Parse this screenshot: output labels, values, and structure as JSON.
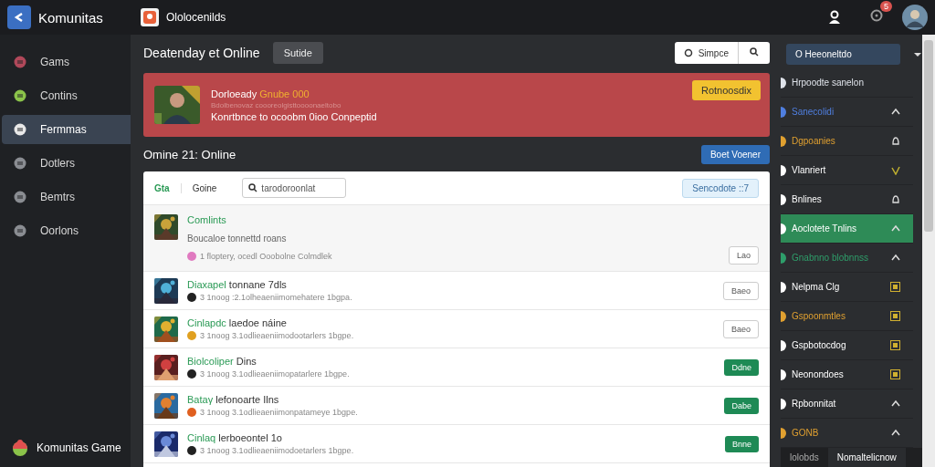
{
  "topbar": {
    "app_title": "Komunitas",
    "tab_title": "Ololocenilds",
    "notification_count": "5"
  },
  "sidebar": {
    "items": [
      {
        "label": "Gams",
        "selected": false,
        "color": "#b0485a"
      },
      {
        "label": "Contins",
        "selected": false,
        "color": "#8bc34a"
      },
      {
        "label": "Fermmas",
        "selected": true,
        "color": "#e8e8e8"
      },
      {
        "label": "Dotlers",
        "selected": false,
        "color": "#8a8d92"
      },
      {
        "label": "Bemtrs",
        "selected": false,
        "color": "#8a8d92"
      },
      {
        "label": "Oorlons",
        "selected": false,
        "color": "#8a8d92"
      }
    ],
    "footer": "Komunitas Game"
  },
  "main": {
    "heading": "Deatenday et Online",
    "heading_button": "Sutide",
    "search_placeholder": "Simpce",
    "banner": {
      "name": "Dorloeady",
      "tag": "Gnube 000",
      "subtitle": "Bdolbenovaz coooreolgisttoooonaeltobo",
      "message": "Konrtbnce to ocoobm 0ioo Conpeptid",
      "button": "Rotnoosdix"
    },
    "section_title": "Omine 21: Online",
    "section_button": "Boet Voener",
    "list": {
      "tab_label": "Gta",
      "filter_label": "Goine",
      "search_placeholder": "tarodoroonlat",
      "sort_button": "Sencodote ::7",
      "rows": [
        {
          "title_highlight": "Comlints",
          "title": "",
          "description": "Boucaloe tonnettd roans",
          "meta": "1 floptery, ocedl Ooobolne Colmdlek",
          "button": "Lao",
          "kind": "outline"
        },
        {
          "title_highlight": "Diaxapel",
          "title": "tonnane 7dls",
          "meta": "3 1noog :2.1olheaeniimomehatere 1bgpa.",
          "button": "Baeo",
          "kind": "outline"
        },
        {
          "title_highlight": "Cinlapdc",
          "title": "laedoe náine",
          "meta": "3 1noog 3.1odlieaeniimodootarlers 1bgpe.",
          "button": "Baeo",
          "kind": "outline"
        },
        {
          "title_highlight": "Biolcoliper",
          "title": "Dins",
          "meta": "3 1noog 3.1odlieaeniimopatarlere 1bgpe.",
          "button": "Ddne",
          "kind": "filled"
        },
        {
          "title_highlight": "Bataγ",
          "title": "lefonoarte Ilns",
          "meta": "3 1noog 3.1odlieaeniimonpatameye 1bgpe.",
          "button": "Dabe",
          "kind": "filled"
        },
        {
          "title_highlight": "Cinlaq",
          "title": "lerboeontel 1o",
          "meta": "3 1noog 3.1odlieaeniimodoetarlers 1bgpe.",
          "button": "Bnne",
          "kind": "filled"
        }
      ]
    }
  },
  "right_panel": {
    "dropdown": "O Heeoneltdo",
    "items": [
      {
        "label": "Hrpoodte sanelon",
        "color": "#dfe3ea",
        "kind": "none",
        "selected": false
      },
      {
        "label": "Sanecolidi",
        "color": "#4f7fe0",
        "kind": "chevron",
        "selected": false
      },
      {
        "label": "Dgpoanies",
        "color": "#e0a030",
        "kind": "bell",
        "selected": false
      },
      {
        "label": "Vlanriert",
        "color": "#ffffff",
        "kind": "check",
        "selected": false
      },
      {
        "label": "Bnlines",
        "color": "#ffffff",
        "kind": "bell",
        "selected": false
      },
      {
        "label": "Aoclotete Tnlins",
        "color": "#ffffff",
        "kind": "chevron",
        "selected": true
      },
      {
        "label": "Gnabnno blobnnss",
        "color": "#2e9e6a",
        "kind": "chevron",
        "selected": false
      },
      {
        "label": "Nelpma Clg",
        "color": "#ffffff",
        "kind": "square",
        "selected": false
      },
      {
        "label": "Gspoonmtles",
        "color": "#e0a030",
        "kind": "square",
        "selected": false
      },
      {
        "label": "Gspbotocdog",
        "color": "#ffffff",
        "kind": "square",
        "selected": false
      },
      {
        "label": "Neonondoes",
        "color": "#ffffff",
        "kind": "square",
        "selected": false
      },
      {
        "label": "Rpbonnitat",
        "color": "#ffffff",
        "kind": "chevron",
        "selected": false
      },
      {
        "label": "GONB",
        "color": "#e0a030",
        "kind": "chevron",
        "selected": false
      }
    ],
    "bottom_tabs": [
      {
        "label": "lolobds",
        "selected": false
      },
      {
        "label": "Nomaltelicnow",
        "selected": true
      }
    ]
  }
}
